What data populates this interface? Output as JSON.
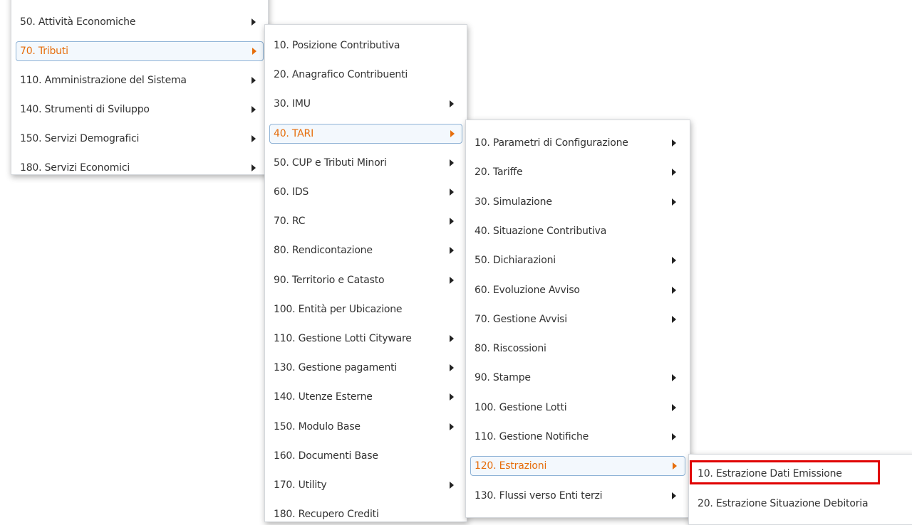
{
  "menu1": [
    {
      "label": "50. Attività Economiche",
      "submenu": true
    },
    {
      "label": "70. Tributi",
      "submenu": true,
      "active": true
    },
    {
      "label": "110. Amministrazione del Sistema",
      "submenu": true
    },
    {
      "label": "140. Strumenti di Sviluppo",
      "submenu": true
    },
    {
      "label": "150. Servizi Demografici",
      "submenu": true
    },
    {
      "label": "180. Servizi Economici",
      "submenu": true
    }
  ],
  "menu2": [
    {
      "label": "10. Posizione Contributiva",
      "submenu": false
    },
    {
      "label": "20. Anagrafico Contribuenti",
      "submenu": false
    },
    {
      "label": "30. IMU",
      "submenu": true
    },
    {
      "label": "40. TARI",
      "submenu": true,
      "active": true
    },
    {
      "label": "50. CUP e Tributi Minori",
      "submenu": true
    },
    {
      "label": "60. IDS",
      "submenu": true
    },
    {
      "label": "70. RC",
      "submenu": true
    },
    {
      "label": "80. Rendicontazione",
      "submenu": true
    },
    {
      "label": "90. Territorio e Catasto",
      "submenu": true
    },
    {
      "label": "100. Entità per Ubicazione",
      "submenu": false
    },
    {
      "label": "110. Gestione Lotti Cityware",
      "submenu": true
    },
    {
      "label": "130. Gestione pagamenti",
      "submenu": true
    },
    {
      "label": "140. Utenze Esterne",
      "submenu": true
    },
    {
      "label": "150. Modulo Base",
      "submenu": true
    },
    {
      "label": "160. Documenti Base",
      "submenu": false
    },
    {
      "label": "170. Utility",
      "submenu": true
    },
    {
      "label": "180. Recupero Crediti",
      "submenu": false
    }
  ],
  "menu3": [
    {
      "label": "10. Parametri di Configurazione",
      "submenu": true
    },
    {
      "label": "20. Tariffe",
      "submenu": true
    },
    {
      "label": "30. Simulazione",
      "submenu": true
    },
    {
      "label": "40. Situazione Contributiva",
      "submenu": false
    },
    {
      "label": "50. Dichiarazioni",
      "submenu": true
    },
    {
      "label": "60. Evoluzione Avviso",
      "submenu": true
    },
    {
      "label": "70. Gestione Avvisi",
      "submenu": true
    },
    {
      "label": "80. Riscossioni",
      "submenu": false
    },
    {
      "label": "90. Stampe",
      "submenu": true
    },
    {
      "label": "100. Gestione Lotti",
      "submenu": true
    },
    {
      "label": "110. Gestione Notifiche",
      "submenu": true
    },
    {
      "label": "120. Estrazioni",
      "submenu": true,
      "active": true
    },
    {
      "label": "130. Flussi verso Enti terzi",
      "submenu": true
    }
  ],
  "menu4": [
    {
      "label": "10. Estrazione Dati Emissione",
      "submenu": false,
      "highlighted": true
    },
    {
      "label": "20. Estrazione Situazione Debitoria",
      "submenu": false
    }
  ],
  "colors": {
    "active_text": "#e66d0b",
    "active_border": "#8fb3d6",
    "highlight_border": "#e00000"
  }
}
